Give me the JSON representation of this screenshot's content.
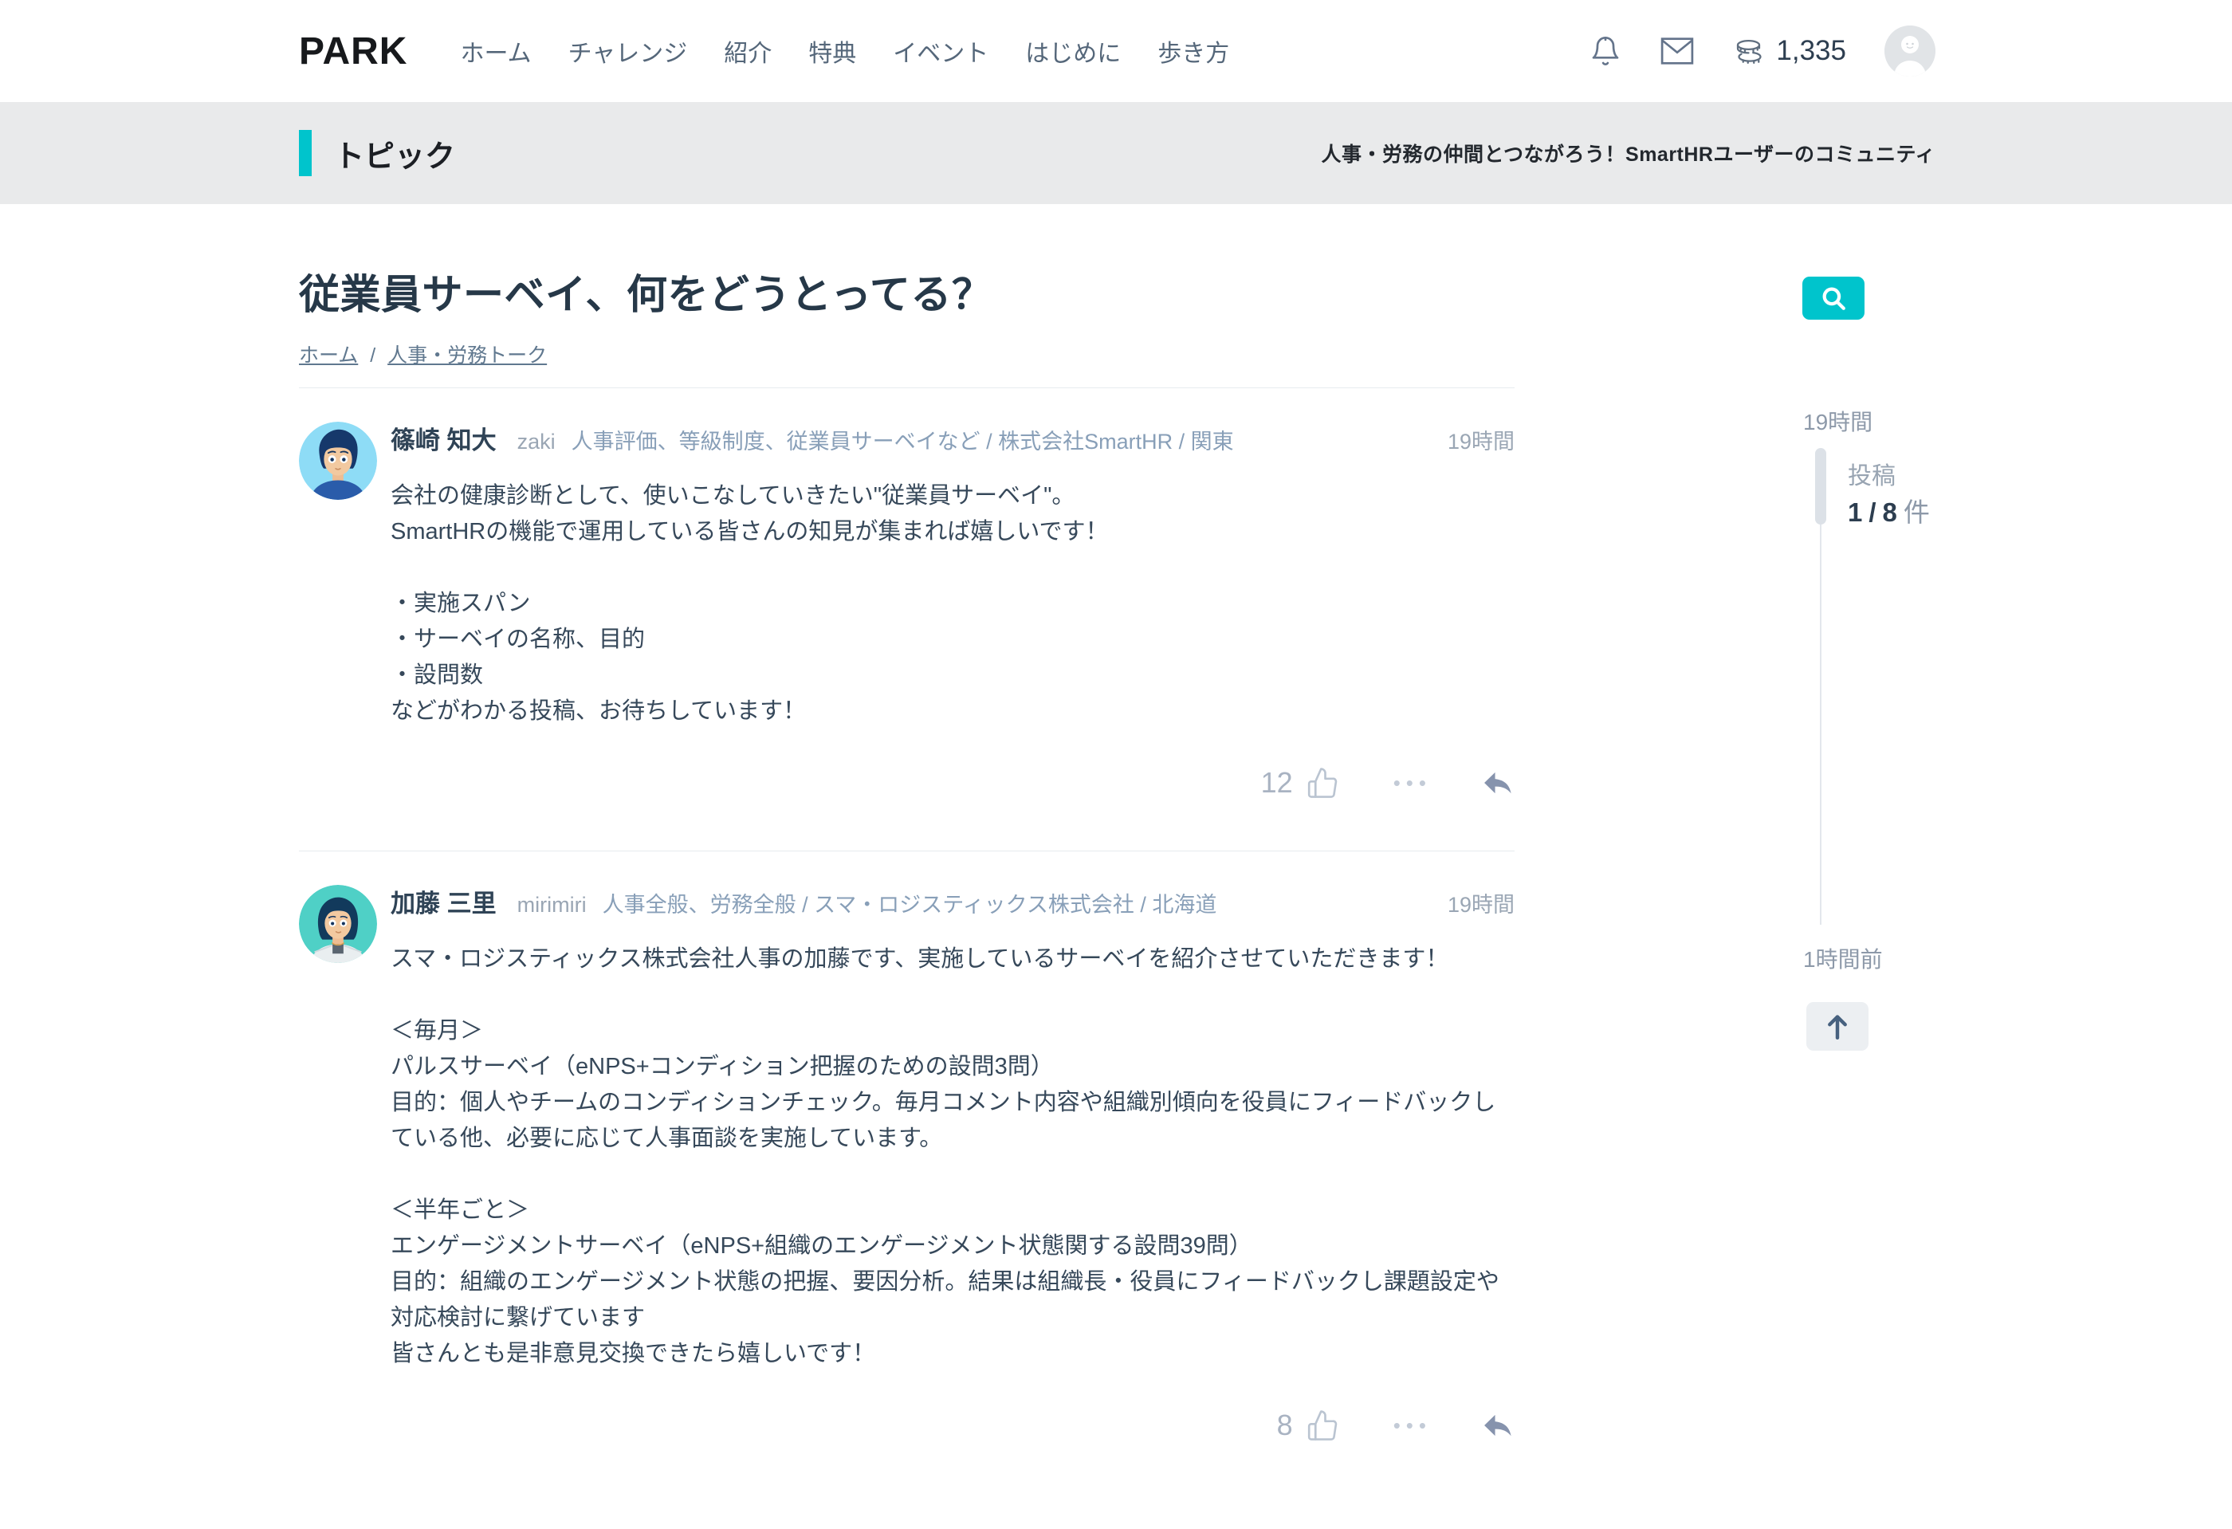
{
  "header": {
    "logo": "PARK",
    "nav": [
      "ホーム",
      "チャレンジ",
      "紹介",
      "特典",
      "イベント",
      "はじめに",
      "歩き方"
    ],
    "coin_count": "1,335"
  },
  "banner": {
    "title": "トピック",
    "tagline": "人事・労務の仲間とつながろう！SmartHRユーザーのコミュニティ"
  },
  "topic": {
    "title": "従業員サーベイ、何をどうとってる？",
    "breadcrumb_home": "ホーム",
    "breadcrumb_sep": "/",
    "breadcrumb_category": "人事・労務トーク"
  },
  "posts": [
    {
      "author": "篠崎 知大",
      "username": "zaki",
      "tags": "人事評価、等級制度、従業員サーベイなど / 株式会社SmartHR / 関東",
      "time": "19時間",
      "likes": "12",
      "ellipsis": "•••",
      "body": "会社の健康診断として、使いこなしていきたい\"従業員サーベイ\"。\nSmartHRの機能で運用している皆さんの知見が集まれば嬉しいです！\n\n・実施スパン\n・サーベイの名称、目的\n・設問数\nなどがわかる投稿、お待ちしています！"
    },
    {
      "author": "加藤 三里",
      "username": "mirimiri",
      "tags": "人事全般、労務全般 / スマ・ロジスティックス株式会社 / 北海道",
      "time": "19時間",
      "likes": "8",
      "ellipsis": "•••",
      "body": "スマ・ロジスティックス株式会社人事の加藤です、実施しているサーベイを紹介させていただきます！\n\n＜毎月＞\nパルスサーベイ（eNPS+コンディション把握のための設問3問）\n目的：個人やチームのコンディションチェック。毎月コメント内容や組織別傾向を役員にフィードバックしている他、必要に応じて人事面談を実施しています。\n\n＜半年ごと＞\nエンゲージメントサーベイ（eNPS+組織のエンゲージメント状態関する設問39問）\n目的：組織のエンゲージメント状態の把握、要因分析。結果は組織長・役員にフィードバックし課題設定や対応検討に繋げています\n皆さんとも是非意見交換できたら嬉しいです！"
    }
  ],
  "sidebar": {
    "latest_time": "19時間",
    "posts_label": "投稿",
    "current": "1",
    "separator": "/",
    "total": "8",
    "unit": "件",
    "oldest_time": "1時間前"
  },
  "colors": {
    "accent": "#00c4cc",
    "banner_bg": "#e9eaeb",
    "text_dark": "#263848",
    "text_muted": "#9aa6b4"
  }
}
